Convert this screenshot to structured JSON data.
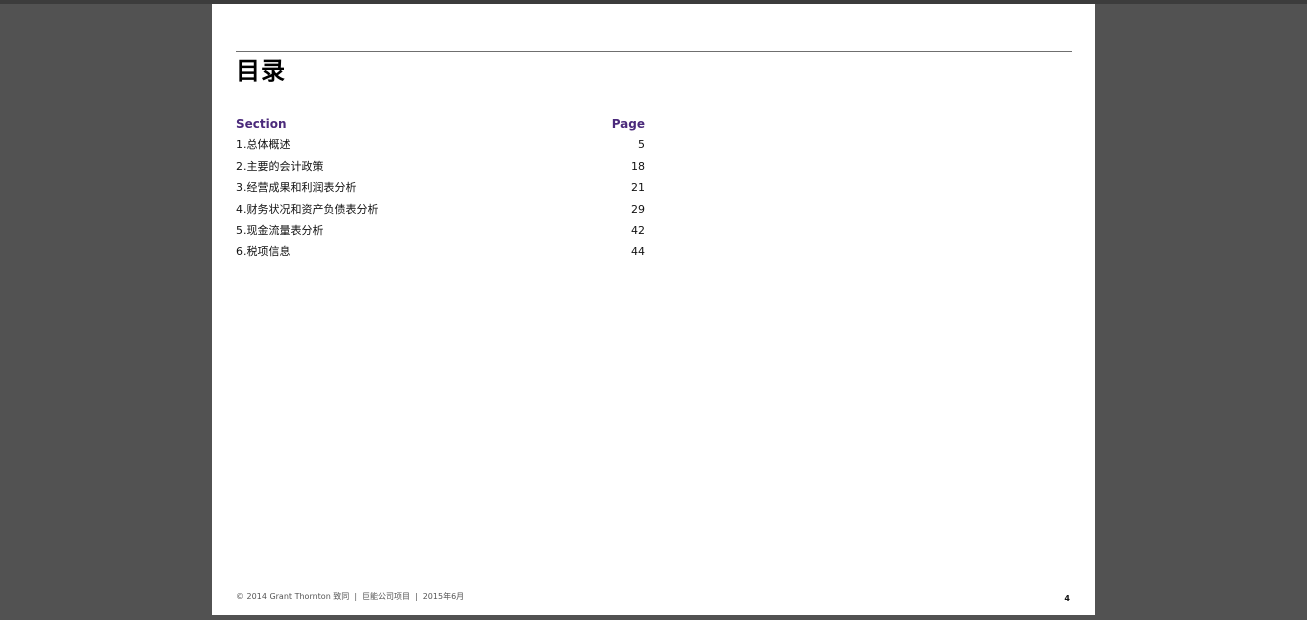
{
  "document": {
    "title": "目录",
    "toc": {
      "section_header": "Section",
      "page_header": "Page",
      "rows": [
        {
          "label": "1.总体概述",
          "page": "5"
        },
        {
          "label": "2.主要的会计政策",
          "page": "18"
        },
        {
          "label": "3.经营成果和利润表分析",
          "page": "21"
        },
        {
          "label": "4.财务状况和资产负债表分析",
          "page": "29"
        },
        {
          "label": "5.现金流量表分析",
          "page": "42"
        },
        {
          "label": "6.税项信息",
          "page": "44"
        }
      ]
    },
    "footer": {
      "copyright": "© 2014 Grant Thornton 致同",
      "separator": "|",
      "project": "巨能公司项目",
      "date": "2015年6月"
    },
    "page_number": "4"
  }
}
